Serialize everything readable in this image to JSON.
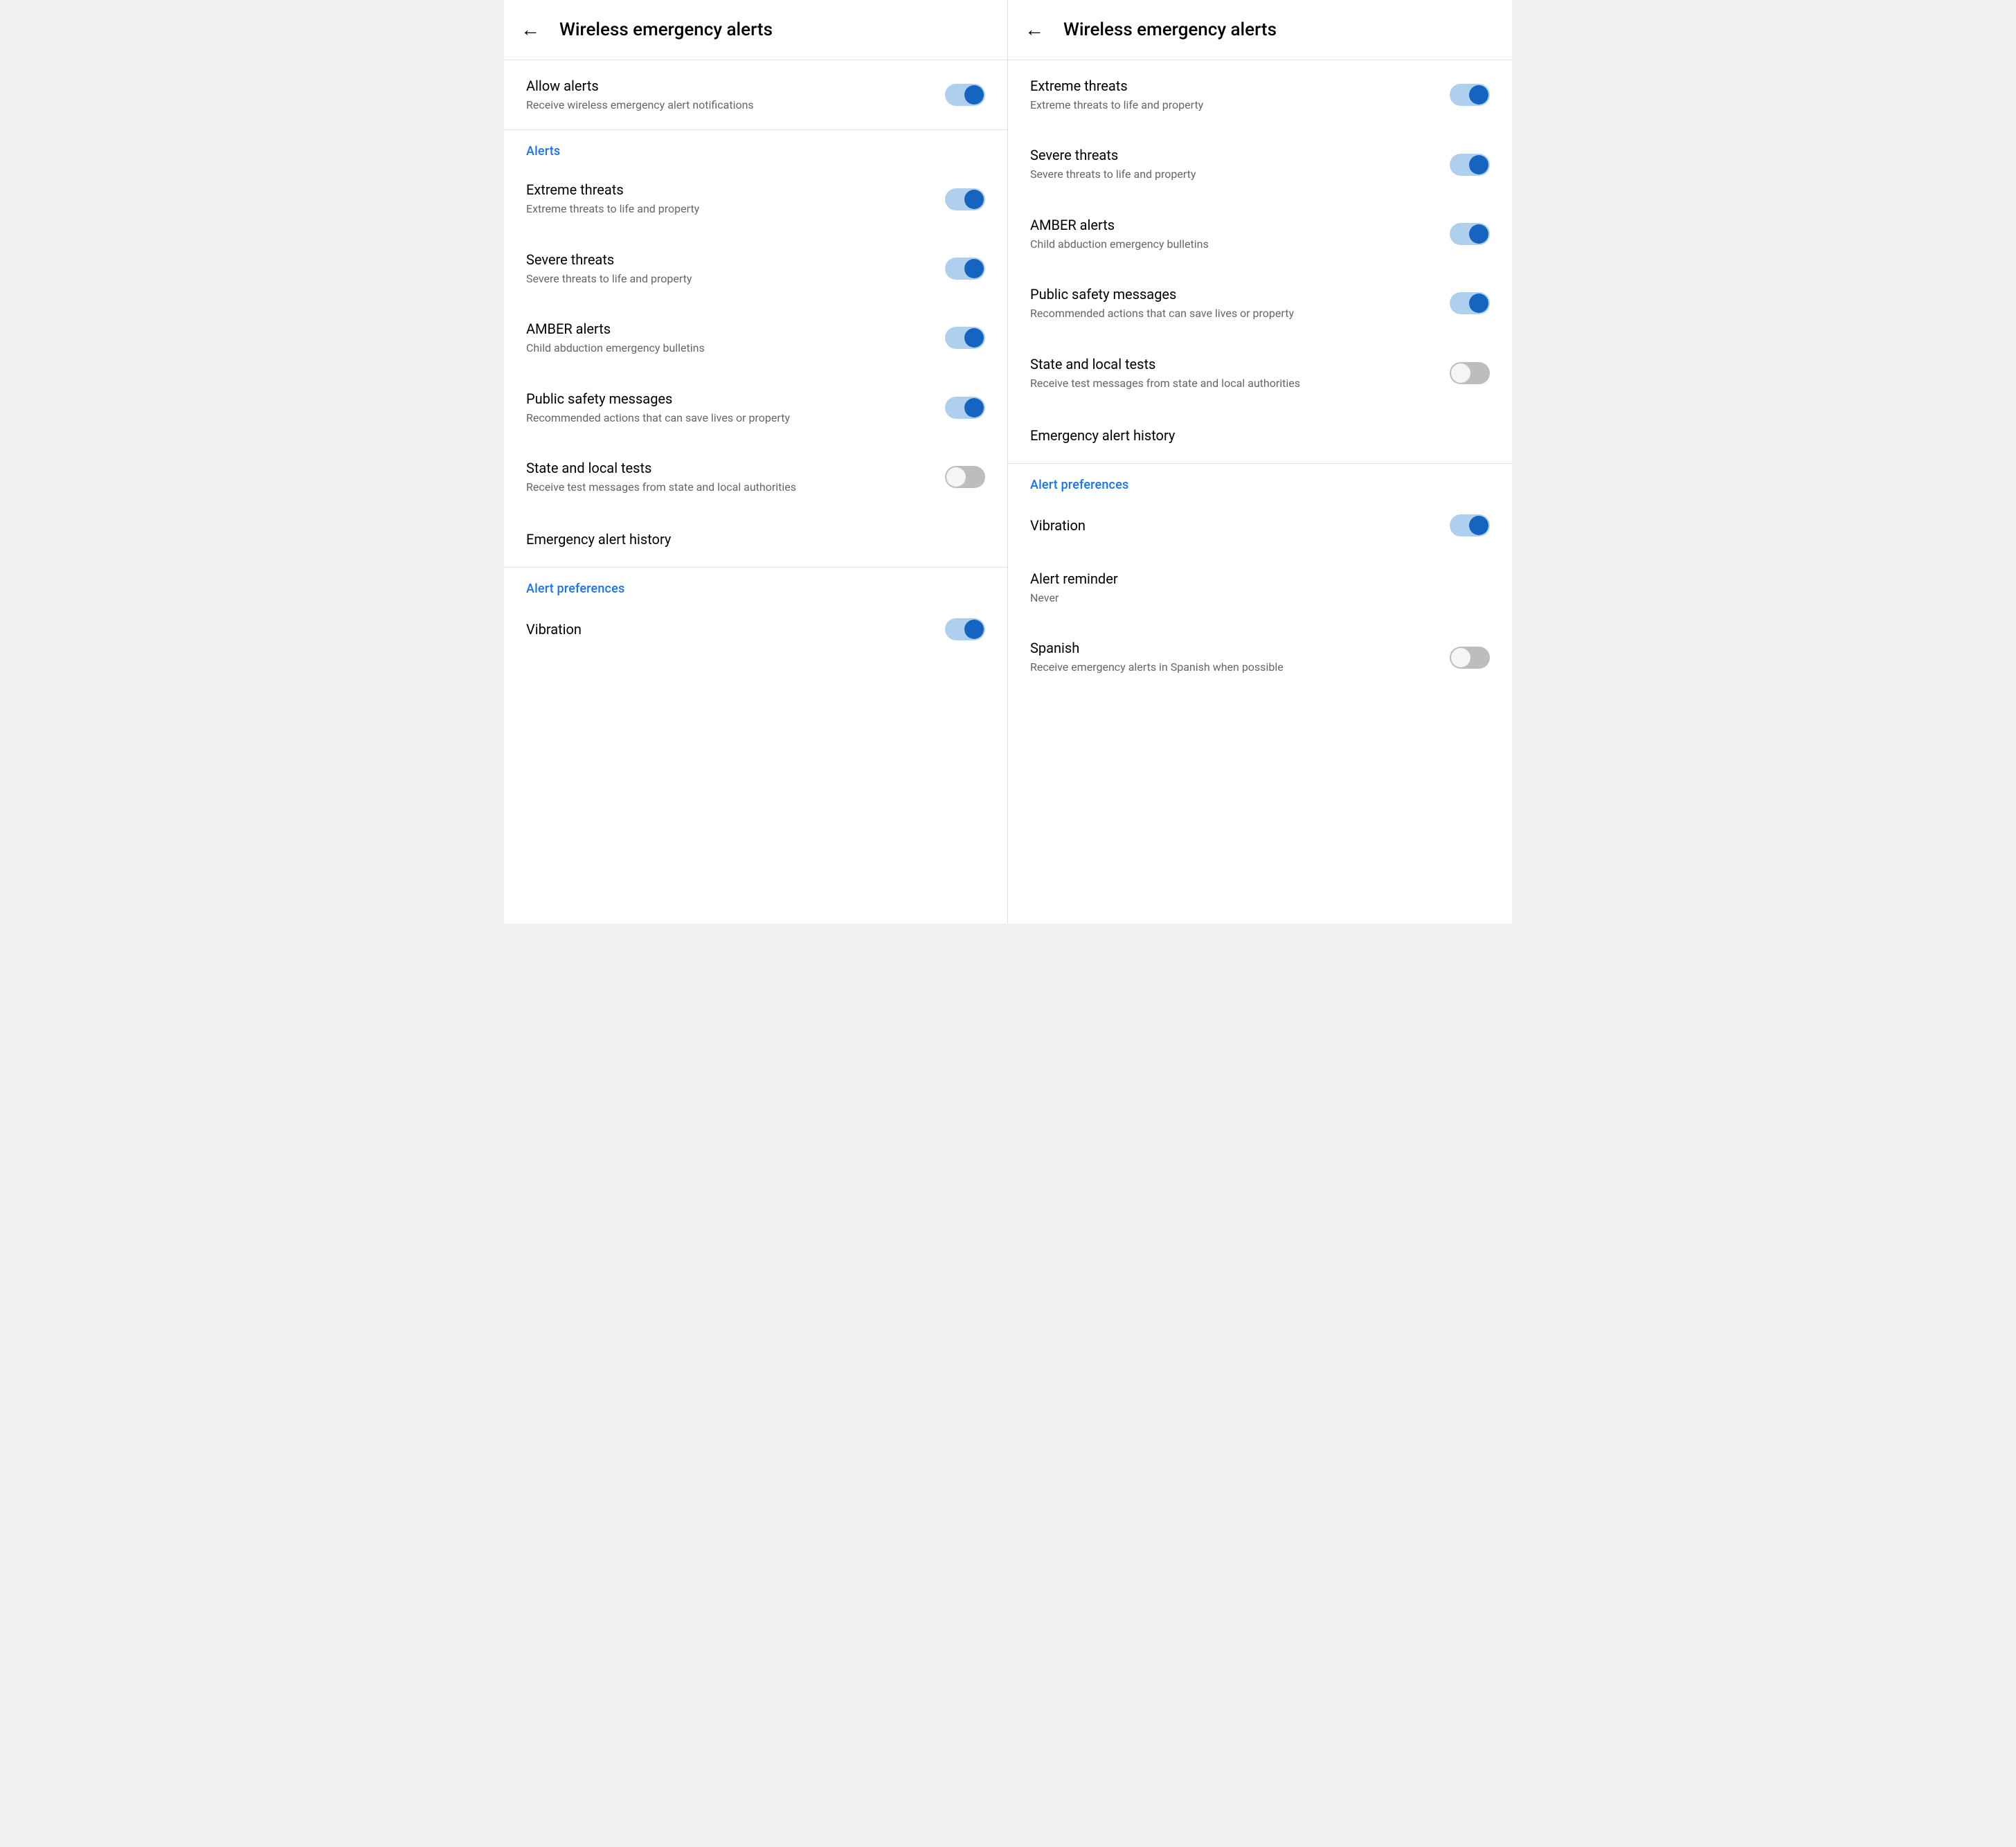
{
  "left_screen": {
    "header": {
      "back_label": "←",
      "title": "Wireless emergency alerts"
    },
    "allow_alerts": {
      "title": "Allow alerts",
      "subtitle": "Receive wireless emergency alert notifications",
      "toggle_on": true
    },
    "alerts_section_label": "Alerts",
    "alerts": [
      {
        "id": "extreme-threats",
        "title": "Extreme threats",
        "subtitle": "Extreme threats to life and property",
        "toggle_on": true
      },
      {
        "id": "severe-threats",
        "title": "Severe threats",
        "subtitle": "Severe threats to life and property",
        "toggle_on": true
      },
      {
        "id": "amber-alerts",
        "title": "AMBER alerts",
        "subtitle": "Child abduction emergency bulletins",
        "toggle_on": true
      },
      {
        "id": "public-safety",
        "title": "Public safety messages",
        "subtitle": "Recommended actions that can save lives or property",
        "toggle_on": true
      },
      {
        "id": "state-local-tests",
        "title": "State and local tests",
        "subtitle": "Receive test messages from state and local authorities",
        "toggle_on": false
      }
    ],
    "emergency_history_label": "Emergency alert history",
    "preferences_section_label": "Alert preferences",
    "vibration": {
      "title": "Vibration",
      "toggle_on": true
    }
  },
  "right_screen": {
    "header": {
      "back_label": "←",
      "title": "Wireless emergency alerts"
    },
    "alerts": [
      {
        "id": "extreme-threats",
        "title": "Extreme threats",
        "subtitle": "Extreme threats to life and property",
        "toggle_on": true
      },
      {
        "id": "severe-threats",
        "title": "Severe threats",
        "subtitle": "Severe threats to life and property",
        "toggle_on": true
      },
      {
        "id": "amber-alerts",
        "title": "AMBER alerts",
        "subtitle": "Child abduction emergency bulletins",
        "toggle_on": true
      },
      {
        "id": "public-safety",
        "title": "Public safety messages",
        "subtitle": "Recommended actions that can save lives or property",
        "toggle_on": true
      },
      {
        "id": "state-local-tests",
        "title": "State and local tests",
        "subtitle": "Receive test messages from state and local authorities",
        "toggle_on": false
      }
    ],
    "emergency_history_label": "Emergency alert history",
    "preferences_section_label": "Alert preferences",
    "vibration": {
      "title": "Vibration",
      "toggle_on": true
    },
    "alert_reminder": {
      "title": "Alert reminder",
      "subtitle": "Never"
    },
    "spanish": {
      "title": "Spanish",
      "subtitle": "Receive emergency alerts in Spanish when possible",
      "toggle_on": false
    }
  }
}
